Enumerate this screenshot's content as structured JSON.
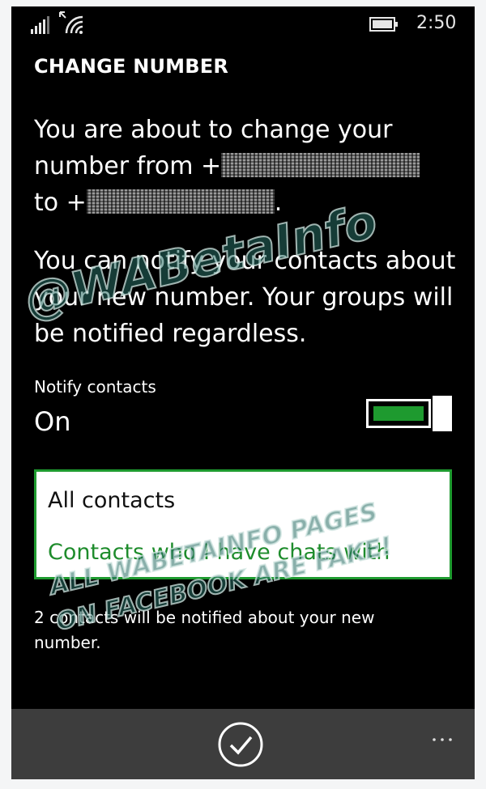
{
  "status_bar": {
    "time": "2:50",
    "icons": [
      "signal-icon",
      "wifi-icon",
      "battery-icon"
    ]
  },
  "page": {
    "title": "CHANGE NUMBER"
  },
  "change_message": {
    "line1": "You are about to change your",
    "from_prefix": "number from +",
    "to_prefix": "to +",
    "to_suffix": "."
  },
  "notify_message": "You can notify your contacts about your new number. Your groups will be notified regardless.",
  "notify_contacts": {
    "label": "Notify contacts",
    "state": "On",
    "enabled": true
  },
  "audience_options": [
    {
      "label": "All contacts",
      "selected": false
    },
    {
      "label": "Contacts who I have chats with",
      "selected": true
    }
  ],
  "footnote": "2 contacts will be notified about your new number.",
  "app_bar": {
    "primary_icon": "check-circle-icon",
    "more_label": "..."
  },
  "watermark": {
    "main": "@WABetaInfo",
    "line1": "ALL WABETAINFO PAGES",
    "line2": "ON FACEBOOK ARE FAKE!"
  },
  "colors": {
    "accent": "#1e9a2f",
    "background": "#000000",
    "app_bar": "#3d3d3d"
  }
}
